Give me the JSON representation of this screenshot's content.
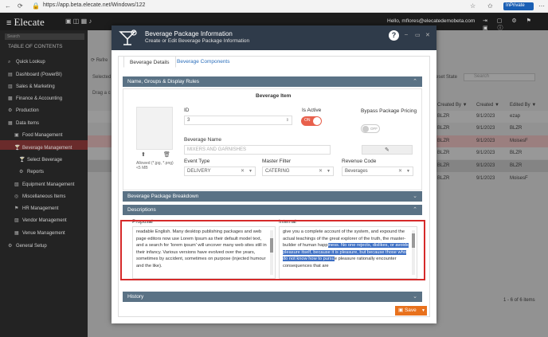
{
  "browser": {
    "url": "https://app.beta.elecate.net/Windows/122",
    "inprivate": "InPrivate"
  },
  "app": {
    "logo": "Elecate",
    "hello": "Hello, mflores@elecatedemobeta.com"
  },
  "sidebar": {
    "search_placeholder": "Search",
    "toc": "TABLE OF CONTENTS",
    "items": [
      {
        "label": "Quick Lookup",
        "icon": "search-icon"
      },
      {
        "label": "Dashboard (PowerBI)",
        "icon": "dashboard-icon"
      },
      {
        "label": "Sales & Marketing",
        "icon": "chart-icon"
      },
      {
        "label": "Finance & Accounting",
        "icon": "finance-icon"
      },
      {
        "label": "Production",
        "icon": "gear-icon"
      },
      {
        "label": "Data Items",
        "icon": "list-icon"
      },
      {
        "label": "Food Management",
        "icon": "food-icon"
      },
      {
        "label": "Beverage Management",
        "icon": "beverage-icon"
      },
      {
        "label": "Select Beverage",
        "icon": "beverage-icon"
      },
      {
        "label": "Reports",
        "icon": "gear-icon"
      },
      {
        "label": "Equipment Management",
        "icon": "equipment-icon"
      },
      {
        "label": "Miscellaneous Items",
        "icon": "misc-icon"
      },
      {
        "label": "HR Management",
        "icon": "hr-icon"
      },
      {
        "label": "Vendor Management",
        "icon": "vendor-icon"
      },
      {
        "label": "Venue Management",
        "icon": "venue-icon"
      },
      {
        "label": "General Setup",
        "icon": "gear-icon"
      }
    ]
  },
  "grid": {
    "refresh": "Refre",
    "selected": "Selected",
    "drag": "Drag a c",
    "reset_state": "eset State",
    "search_placeholder": "Search",
    "headers": [
      "Created By",
      "Created",
      "Edited By"
    ],
    "rows": [
      [
        "BLZR",
        "9/1/2023",
        "ezap"
      ],
      [
        "BLZR",
        "9/1/2023",
        "BLZR"
      ],
      [
        "BLZR",
        "9/1/2023",
        "MoisesF"
      ],
      [
        "BLZR",
        "9/1/2023",
        "BLZR"
      ],
      [
        "BLZR",
        "9/1/2023",
        "BLZR"
      ],
      [
        "BLZR",
        "9/1/2023",
        "MoisesF"
      ]
    ],
    "pager": "1 - 6 of 6 items"
  },
  "modal": {
    "title": "Beverage Package Information",
    "subtitle": "Create or Edit Beverage Package Information",
    "tabs": [
      "Beverage Details",
      "Beverage Components"
    ],
    "sections": {
      "names": "Name, Groups & Display Rules",
      "breakdown": "Beverage Package Breakdown",
      "descriptions": "Descriptions",
      "history": "History"
    },
    "item": {
      "heading": "Beverage Item",
      "id_label": "ID",
      "id_value": "3",
      "active_label": "Is Active",
      "active_value": "ON",
      "bypass_label": "Bypass Package Pricing",
      "bypass_value": "OFF",
      "name_label": "Beverage Name",
      "name_placeholder": "MIXERS AND GARNISHES",
      "allowed": "Allowed (*.jpg, *.png) <5 MB",
      "event_label": "Event Type",
      "event_value": "DELIVERY",
      "filter_label": "Master Filter",
      "filter_value": "CATERING",
      "revenue_label": "Revenue Code",
      "revenue_value": "Beverages"
    },
    "desc": {
      "proposal_label": "Proposal",
      "proposal_text": "readable English. Many desktop publishing packages and web page editors now use Lorem Ipsum as their default model text, and a search for 'lorem ipsum' will uncover many web sites still in their infancy. Various versions have evolved over the years, sometimes by accident, sometimes on purpose (injected humour and the like).",
      "internal_label": "Internal",
      "internal_text_a": "give you a complete account of the system, and expound the actual teachings of the great explorer of the truth, the master-builder of human happ",
      "internal_text_hl": "iness. No one rejects, dislikes, or avoids pleasure itself, because it is pleasure, but because those who do not know how to pursu",
      "internal_text_b": "e pleasure rationally encounter consequences that are"
    },
    "save": "Save"
  }
}
